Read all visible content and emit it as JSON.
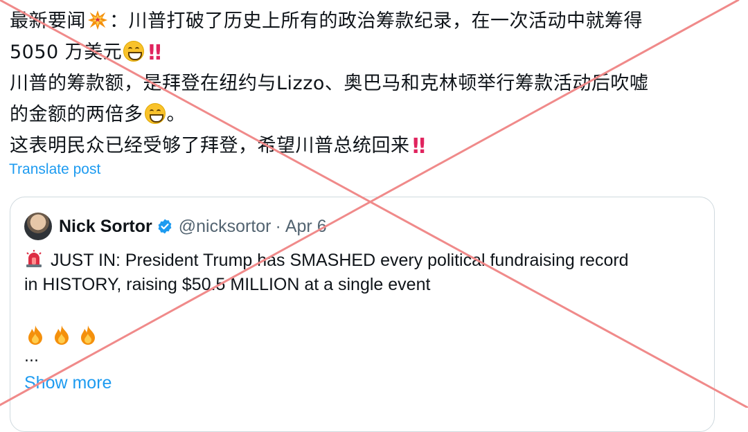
{
  "post": {
    "line1_text": "最新要闻",
    "line1_rest": "：川普打破了历史上所有的政治筹款纪录，在一次活动中就筹得",
    "line2_text": "5050 万美元",
    "line3_text": "川普的筹款额，是拜登在纽约与Lizzo、奥巴马和克林顿举行筹款活动后吹嘘",
    "line4_text": "的金额的两倍多",
    "line4_end": "。",
    "line5_text": "这表明民众已经受够了拜登，希望川普总统回来",
    "double_exclaim": "‼",
    "icons": [
      "collision-emoji",
      "grinning-face-emoji",
      "double-exclamation-emoji"
    ]
  },
  "translate_link": "Translate post",
  "quote": {
    "author_name": "Nick Sortor",
    "author_handle": "@nicksortor",
    "separator": "·",
    "date": "Apr 6",
    "text_line1": "JUST IN: President Trump has SMASHED every political fundraising record",
    "text_line2": "in HISTORY, raising $50.5 MILLION at a single event",
    "ellipsis": "...",
    "show_more": "Show more",
    "icons": [
      "verified-badge-icon",
      "siren-emoji",
      "fire-emoji"
    ]
  },
  "colors": {
    "link_blue": "#1d9bf0",
    "cross_mark": "#f08a8a",
    "border": "#cfd9de"
  }
}
